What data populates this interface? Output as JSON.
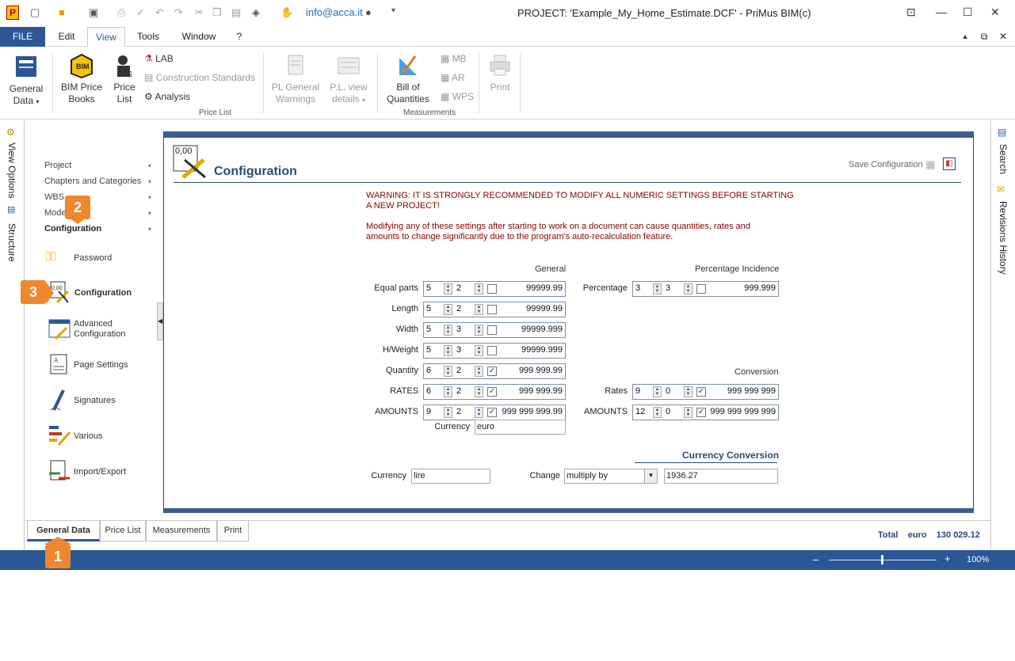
{
  "titlebar": {
    "email": "info@acca.it",
    "title": "PROJECT: 'Example_My_Home_Estimate.DCF' - PriMus   BIM(c)"
  },
  "menu": {
    "file": "FILE",
    "items": [
      "Edit",
      "View",
      "Tools",
      "Window",
      "?"
    ]
  },
  "ribbon": {
    "general_data": [
      "General",
      "Data"
    ],
    "bim_price_books": [
      "BIM Price",
      "Books"
    ],
    "price_list": [
      "Price",
      "List"
    ],
    "lab": "LAB",
    "construction_standards": "Construction Standards",
    "analysis": "Analysis",
    "pl_general_warnings": [
      "PL General",
      "Warnings"
    ],
    "pl_view_details": [
      "P.L. view",
      "details"
    ],
    "group_price_list": "Price List",
    "bill_of_quantities": [
      "Bill of",
      "Quantities"
    ],
    "mb": "MB",
    "ar": "AR",
    "wps": "WPS",
    "group_measurements": "Measurements",
    "print": "Print"
  },
  "left_strip": {
    "view_options": "View Options",
    "structure": "Structure"
  },
  "right_strip": {
    "search": "Search",
    "revisions_history": "Revisions History"
  },
  "nav": {
    "headers": [
      "Project",
      "Chapters and Categories",
      "WBS",
      "Models",
      "Configuration"
    ],
    "items": {
      "password": "Password",
      "configuration": "Configuration",
      "advanced_configuration": [
        "Advanced",
        "Configuration"
      ],
      "page_settings": "Page Settings",
      "signatures": "Signatures",
      "various": "Various",
      "import_export": "Import/Export"
    }
  },
  "badges": {
    "one": "1",
    "two": "2",
    "three": "3"
  },
  "panel": {
    "icon_text": "0,00",
    "title": "Configuration",
    "save_configuration": "Save Configuration",
    "warning_lines": [
      "WARNING: IT IS STRONGLY RECOMMENDED TO MODIFY ALL NUMERIC SETTINGS BEFORE STARTING",
      "A NEW PROJECT!",
      "Modifying any of these settings after starting to work on a document can cause quantities, rates and",
      "amounts to change significantly due to the program's auto-recalculation feature."
    ],
    "general_header": "General",
    "percentage_incidence_header": "Percentage Incidence",
    "conversion_header": "Conversion",
    "general_rows": [
      {
        "label": "Equal parts",
        "a": "5",
        "b": "2",
        "checked": false,
        "sample": "99999.99"
      },
      {
        "label": "Length",
        "a": "5",
        "b": "2",
        "checked": false,
        "sample": "99999.99"
      },
      {
        "label": "Width",
        "a": "5",
        "b": "3",
        "checked": false,
        "sample": "99999.999"
      },
      {
        "label": "H/Weight",
        "a": "5",
        "b": "3",
        "checked": false,
        "sample": "99999.999"
      },
      {
        "label": "Quantity",
        "a": "6",
        "b": "2",
        "checked": true,
        "sample": "999 999.99"
      },
      {
        "label": "RATES",
        "a": "6",
        "b": "2",
        "checked": true,
        "sample": "999 999.99"
      },
      {
        "label": "AMOUNTS",
        "a": "9",
        "b": "2",
        "checked": true,
        "sample": "999 999 999.99"
      }
    ],
    "percentage_row": {
      "label": "Percentage",
      "a": "3",
      "b": "3",
      "checked": false,
      "sample": "999.999"
    },
    "conversion_rows": [
      {
        "label": "Rates",
        "a": "9",
        "b": "0",
        "checked": true,
        "sample": "999 999 999"
      },
      {
        "label": "AMOUNTS",
        "a": "12",
        "b": "0",
        "checked": true,
        "sample": "999 999 999 999"
      }
    ],
    "currency_label": "Currency",
    "currency_value": "euro",
    "currency_conversion_title": "Currency Conversion",
    "conv_currency_label": "Currency",
    "conv_currency_value": "lire",
    "change_label": "Change",
    "change_value": "multiply by",
    "change_rate": "1936.27"
  },
  "bottom_tabs": [
    "General Data",
    "Price List",
    "Measurements",
    "Print"
  ],
  "total": {
    "label": "Total",
    "currency": "euro",
    "value": "130 029.12"
  },
  "status": {
    "zoom": "100%",
    "minus": "–",
    "plus": "+"
  }
}
